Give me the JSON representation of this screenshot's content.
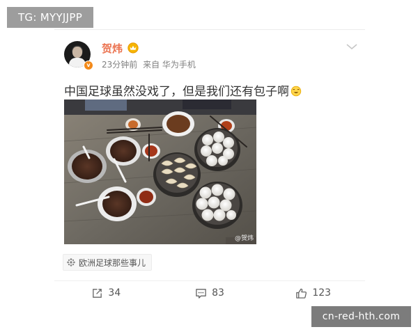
{
  "watermark_top": "TG: MYYJJPP",
  "watermark_bottom": "cn-red-hth.com",
  "post": {
    "username": "贺炜",
    "time": "23分钟前",
    "source": "来自 华为手机",
    "text": "中国足球虽然没戏了，但是我们还有包子啊",
    "image_watermark": "@贺炜",
    "topic_tag": "欧洲足球那些事儿",
    "repost_count": "34",
    "comment_count": "83",
    "like_count": "123"
  },
  "icons": {
    "avatar_badge": "verified-v-icon",
    "vip": "vip-crown-icon",
    "menu": "chevron-down-icon",
    "emoji": "smile-emoji-icon",
    "tag": "topic-wheel-icon",
    "repost": "repost-icon",
    "comment": "comment-icon",
    "like": "thumbs-up-icon"
  },
  "colors": {
    "username": "#eb7350",
    "badge": "#f38a1a"
  }
}
